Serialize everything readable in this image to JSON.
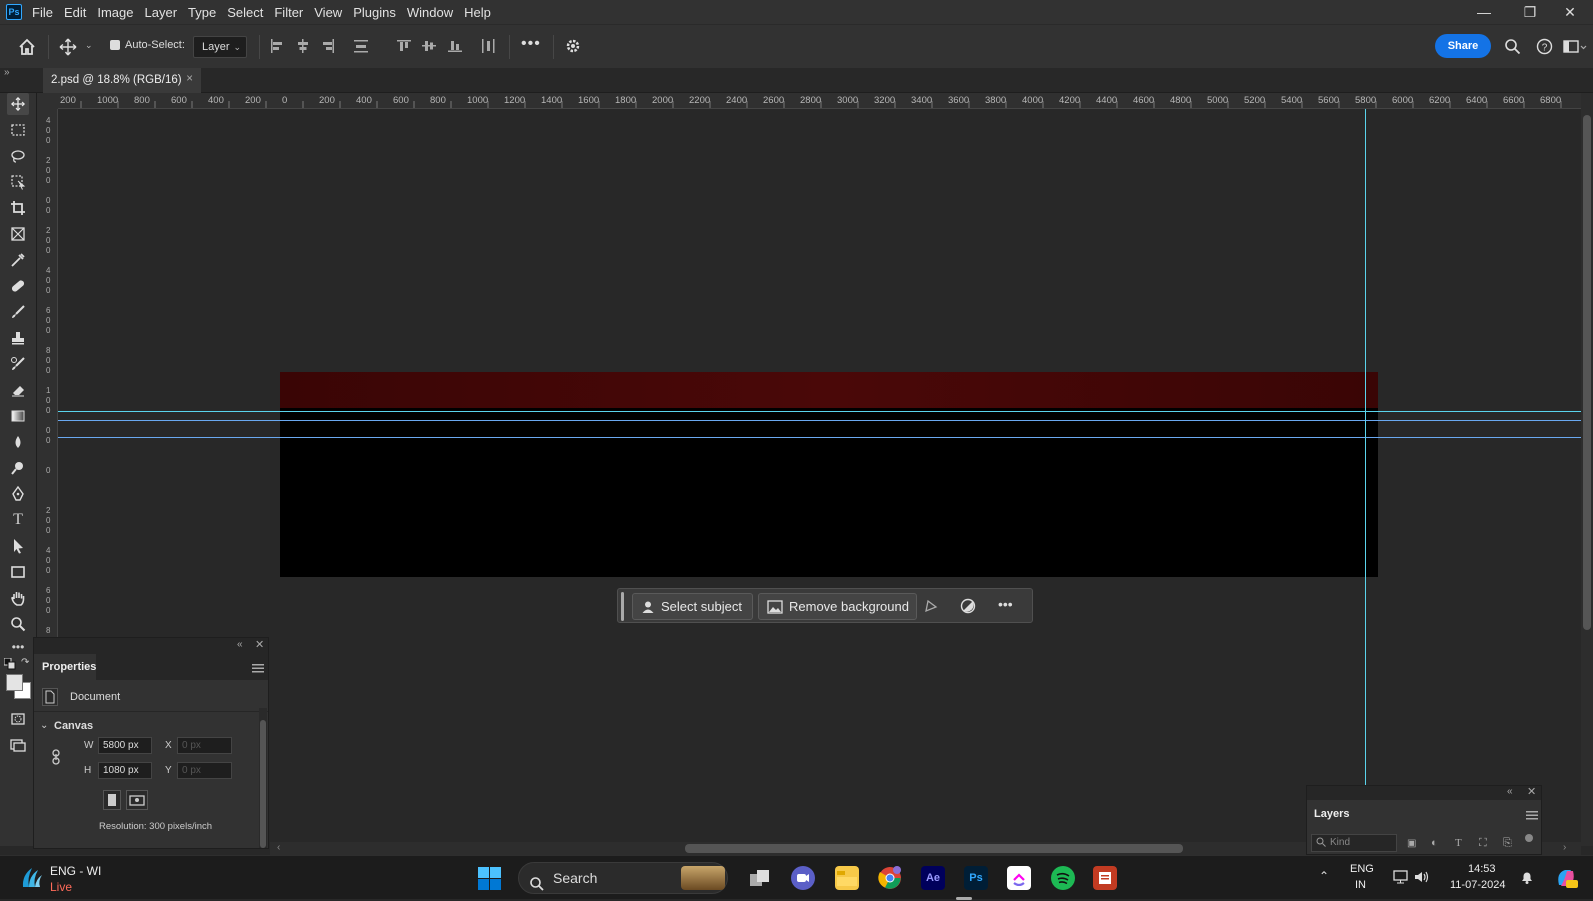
{
  "menu": [
    "File",
    "Edit",
    "Image",
    "Layer",
    "Type",
    "Select",
    "Filter",
    "View",
    "Plugins",
    "Window",
    "Help"
  ],
  "app_logo": "Ps",
  "window_controls": {
    "minimize": "—",
    "restore": "❐",
    "close": "✕"
  },
  "options": {
    "auto_select_label": "Auto-Select:",
    "auto_select_target": "Layer",
    "share_label": "Share"
  },
  "document_tab": {
    "title": "2.psd @ 18.8% (RGB/16)",
    "close": "×"
  },
  "ruler": {
    "top_ticks": [
      "200",
      "1000",
      "800",
      "600",
      "400",
      "200",
      "0",
      "200",
      "400",
      "600",
      "800",
      "1000",
      "1200",
      "1400",
      "1600",
      "1800",
      "2000",
      "2200",
      "2400",
      "2600",
      "2800",
      "3000",
      "3200",
      "3400",
      "3600",
      "3800",
      "4000",
      "4200",
      "4400",
      "4600",
      "4800",
      "5000",
      "5200",
      "5400",
      "5600",
      "5800",
      "6000",
      "6200",
      "6400",
      "6600",
      "6800"
    ]
  },
  "context_bar": {
    "select_subject": "Select subject",
    "remove_background": "Remove background"
  },
  "properties": {
    "panel_title": "Properties",
    "type": "Document",
    "section": "Canvas",
    "w_label": "W",
    "h_label": "H",
    "x_label": "X",
    "y_label": "Y",
    "width": "5800 px",
    "height": "1080 px",
    "x_placeholder": "0 px",
    "y_placeholder": "0 px",
    "resolution": "Resolution: 300 pixels/inch"
  },
  "layers": {
    "panel_title": "Layers",
    "filter_placeholder": "Kind"
  },
  "taskbar": {
    "weather_title": "ENG - WI",
    "weather_status": "Live",
    "search": "Search",
    "lang_top": "ENG",
    "lang_bottom": "IN",
    "time": "14:53",
    "date": "11-07-2024",
    "ae_label": "Ae",
    "ps_label": "Ps"
  },
  "colors": {
    "accent": "#1473e6",
    "guide": "#5ad4ec",
    "canvas": "#000000",
    "banner": "#4a0808"
  }
}
